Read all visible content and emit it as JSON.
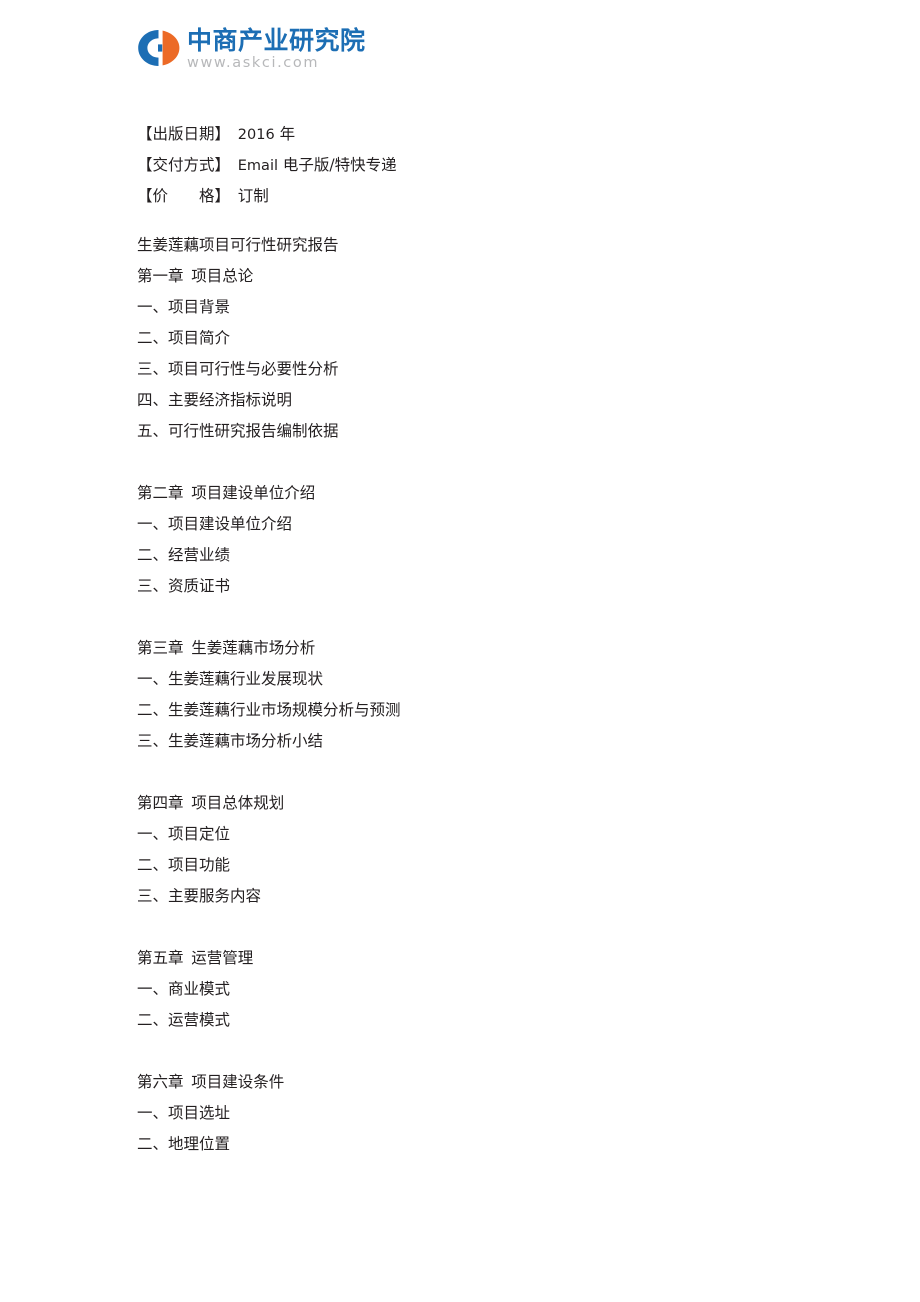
{
  "logo": {
    "mark_name": "askci-c-mark",
    "company_cn": "中商产业研究院",
    "website": "www.askci.com",
    "blue": "#1c6eb4",
    "orange": "#ec6a26",
    "url_gray": "#b7b8ba"
  },
  "meta": [
    {
      "label": "【出版日期】",
      "value": "2016",
      "value_cn": " 年"
    },
    {
      "label": "【交付方式】",
      "value": "Email",
      "value_cn": " 电子版/特快专递"
    },
    {
      "label": "【价　　格】",
      "value": "",
      "value_cn": "订制"
    }
  ],
  "document": {
    "title": "生姜莲藕项目可行性研究报告"
  },
  "chapters": [
    {
      "heading": "第一章  项目总论",
      "items": [
        "一、项目背景",
        "二、项目简介",
        "三、项目可行性与必要性分析",
        "四、主要经济指标说明",
        "五、可行性研究报告编制依据"
      ]
    },
    {
      "heading": "第二章  项目建设单位介绍",
      "items": [
        "一、项目建设单位介绍",
        "二、经营业绩",
        "三、资质证书"
      ]
    },
    {
      "heading": "第三章  生姜莲藕市场分析",
      "items": [
        "一、生姜莲藕行业发展现状",
        "二、生姜莲藕行业市场规模分析与预测",
        "三、生姜莲藕市场分析小结"
      ]
    },
    {
      "heading": "第四章  项目总体规划",
      "items": [
        "一、项目定位",
        "二、项目功能",
        "三、主要服务内容"
      ]
    },
    {
      "heading": "第五章  运营管理",
      "items": [
        "一、商业模式",
        "二、运营模式"
      ]
    },
    {
      "heading": "第六章  项目建设条件",
      "items": [
        "一、项目选址",
        "二、地理位置"
      ]
    }
  ]
}
